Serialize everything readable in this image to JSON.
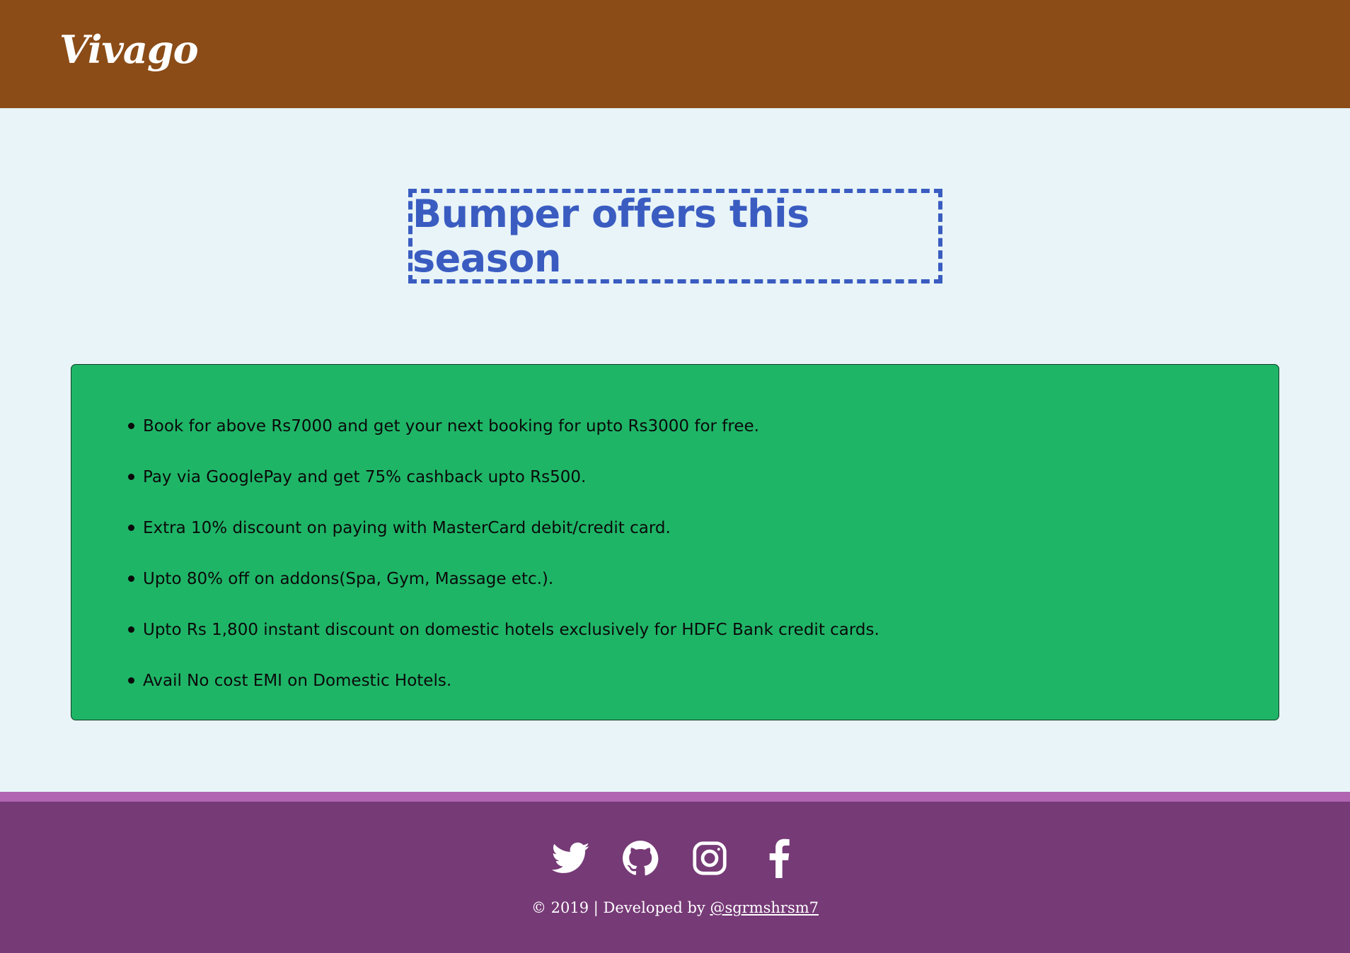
{
  "header": {
    "logo_text": "Vivago",
    "background": "#8b4c17"
  },
  "banner": {
    "title": "Bumper offers this season",
    "color": "#3a5cc1"
  },
  "offers": {
    "background": "#1fb567",
    "items": [
      "Book for above Rs7000 and get your next booking for upto Rs3000 for free.",
      "Pay via GooglePay and get 75% cashback upto Rs500.",
      "Extra 10% discount on paying with MasterCard debit/credit card.",
      "Upto 80% off on addons(Spa, Gym, Massage etc.).",
      "Upto Rs 1,800 instant discount on domestic hotels exclusively for HDFC Bank credit cards.",
      "Avail No cost EMI on Domestic Hotels."
    ]
  },
  "footer": {
    "background": "#763a76",
    "stripe_color": "#b064b1",
    "social_icons": [
      "twitter-icon",
      "github-icon",
      "instagram-icon",
      "facebook-icon"
    ],
    "credit_prefix": "© 2019 | Developed by ",
    "credit_link": "@sgrmshrsm7"
  }
}
